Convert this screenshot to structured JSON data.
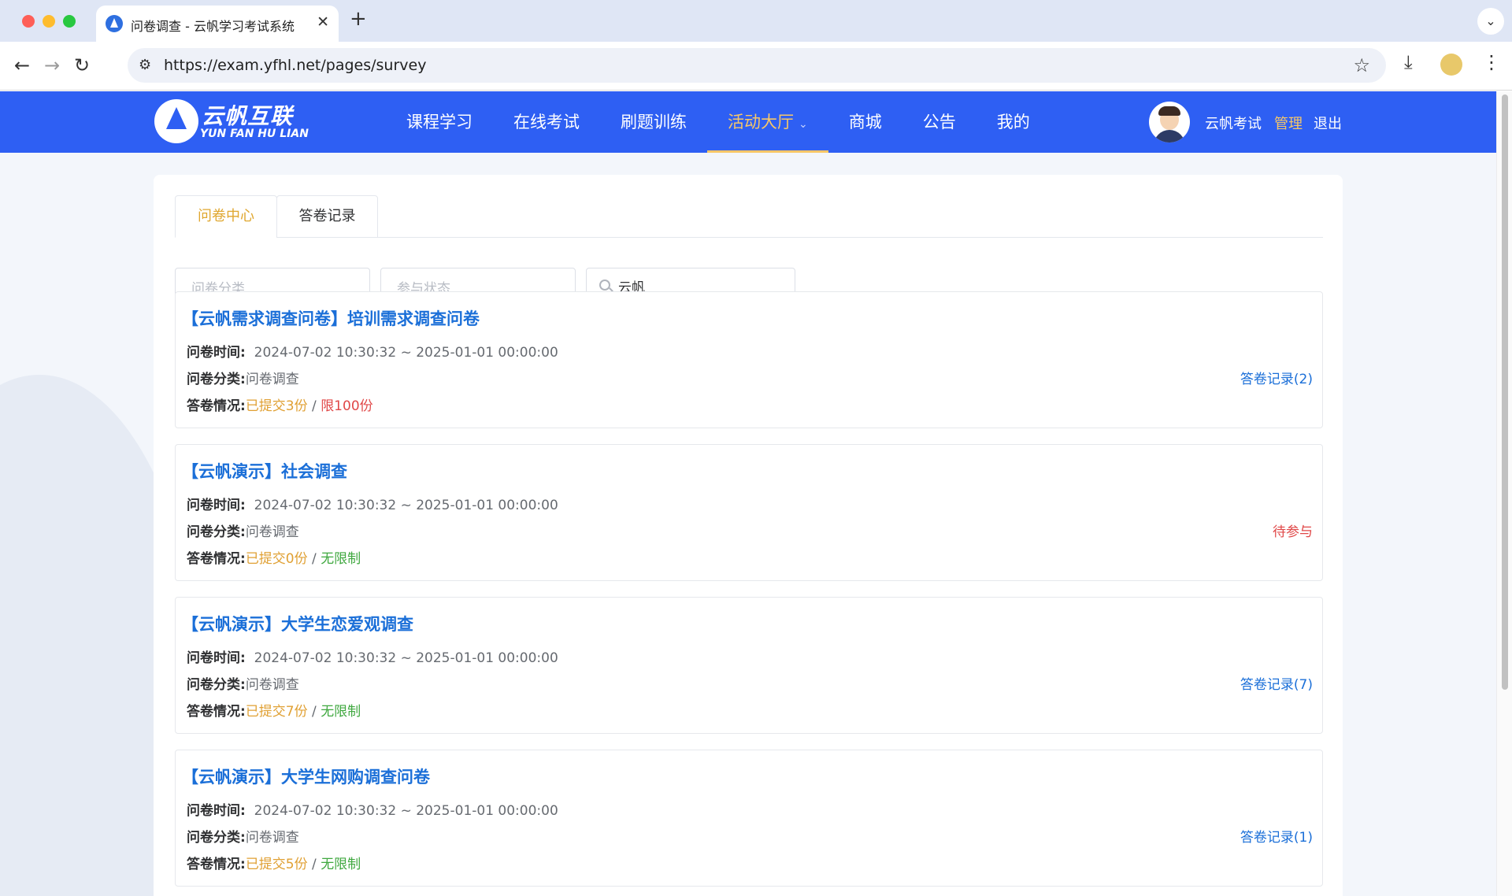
{
  "browser": {
    "tab_title": "问卷调查 - 云帆学习考试系统",
    "url": "https://exam.yfhl.net/pages/survey"
  },
  "header": {
    "logo_title": "云帆互联",
    "logo_subtitle": "YUN FAN HU LIAN",
    "nav": [
      {
        "label": "课程学习"
      },
      {
        "label": "在线考试"
      },
      {
        "label": "刷题训练"
      },
      {
        "label": "活动大厅",
        "active": true
      },
      {
        "label": "商城"
      },
      {
        "label": "公告"
      },
      {
        "label": "我的"
      }
    ],
    "user_name": "云帆考试",
    "admin_label": "管理",
    "logout_label": "退出"
  },
  "tabs": [
    "问卷中心",
    "答卷记录"
  ],
  "filters": {
    "category_placeholder": "问卷分类",
    "status_placeholder": "参与状态",
    "search_value": "云帆"
  },
  "labels": {
    "time": "问卷时间:",
    "category": "问卷分类:",
    "answers": "答卷情况:"
  },
  "surveys": [
    {
      "title": "【云帆需求调查问卷】培训需求调查问卷",
      "time": "2024-07-02 10:30:32 ~ 2025-01-01 00:00:00",
      "category": "问卷调查",
      "submitted": "已提交3份",
      "separator": " / ",
      "limit": "限100份",
      "action": "答卷记录(2)"
    },
    {
      "title": "【云帆演示】社会调查",
      "time": "2024-07-02 10:30:32 ~ 2025-01-01 00:00:00",
      "category": "问卷调查",
      "submitted": "已提交0份",
      "separator": " / ",
      "limit": "无限制",
      "action": "待参与"
    },
    {
      "title": "【云帆演示】大学生恋爱观调查",
      "time": "2024-07-02 10:30:32 ~ 2025-01-01 00:00:00",
      "category": "问卷调查",
      "submitted": "已提交7份",
      "separator": " / ",
      "limit": "无限制",
      "action": "答卷记录(7)"
    },
    {
      "title": "【云帆演示】大学生网购调查问卷",
      "time": "2024-07-02 10:30:32 ~ 2025-01-01 00:00:00",
      "category": "问卷调查",
      "submitted": "已提交5份",
      "separator": " / ",
      "limit": "无限制",
      "action": "答卷记录(1)"
    }
  ],
  "colors": {
    "header_blue": "#2e5ff3",
    "accent_gold": "#f7c768",
    "link_blue": "#1b6fd8",
    "warn_red": "#e04848",
    "ok_green": "#3fa83f"
  }
}
